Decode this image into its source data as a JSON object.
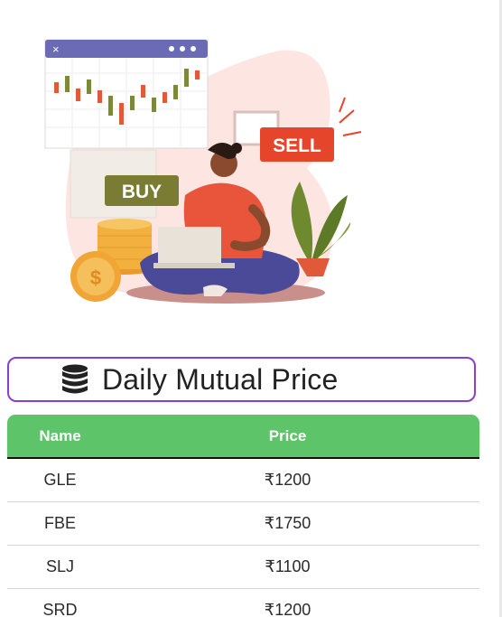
{
  "illustration": {
    "buy_label": "BUY",
    "sell_label": "SELL",
    "icon": "trading-illustration"
  },
  "title": {
    "icon": "database-icon",
    "text": "Daily Mutual Price",
    "border_color": "#8a3fd1"
  },
  "table": {
    "header_color": "#5ec46a",
    "columns": [
      "Name",
      "Price"
    ],
    "rows": [
      {
        "name": "GLE",
        "price": "₹1200"
      },
      {
        "name": "FBE",
        "price": "₹1750"
      },
      {
        "name": "SLJ",
        "price": "₹1100"
      },
      {
        "name": "SRD",
        "price": "₹1200"
      }
    ]
  }
}
